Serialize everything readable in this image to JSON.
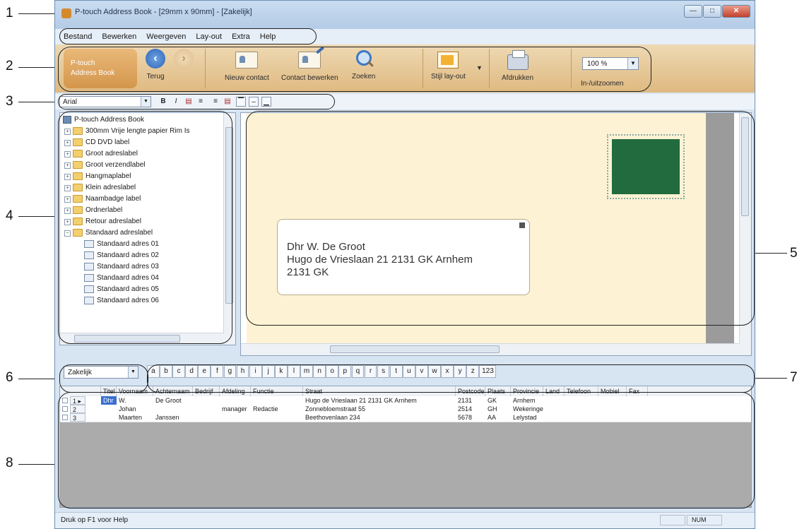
{
  "window": {
    "title": "P-touch Address Book - [29mm x 90mm] - [Zakelijk]",
    "controls": [
      "—",
      "□",
      "✕"
    ]
  },
  "menu": [
    "Bestand",
    "Bewerken",
    "Weergeven",
    "Lay-out",
    "Extra",
    "Help"
  ],
  "ribbon": {
    "brand_line1": "P-touch",
    "brand_line2": "Address Book",
    "back": "Terug",
    "forward": "",
    "new_contact": "Nieuw contact",
    "edit_contact": "Contact bewerken",
    "search": "Zoeken",
    "layout_style": "Stijl lay-out",
    "print": "Afdrukken",
    "zoom_value": "100 %",
    "zoom_label": "In-/uitzoomen"
  },
  "format_bar": {
    "font": "Arial",
    "bold": "B",
    "italic": "I"
  },
  "tree": {
    "root": "P-touch Address Book",
    "folders": [
      "300mm Vrije lengte papier  Rim Is",
      "CD DVD label",
      "Groot adreslabel",
      "Groot verzendlabel",
      "Hangmaplabel",
      "Klein adreslabel",
      "Naambadge label",
      "Ordnerlabel",
      "Retour adreslabel",
      "Standaard adreslabel"
    ],
    "children": [
      "Standaard adres 01",
      "Standaard adres 02",
      "Standaard adres 03",
      "Standaard adres 04",
      "Standaard adres 05",
      "Standaard adres 06"
    ]
  },
  "label_preview": {
    "line1": "Dhr W. De Groot",
    "line2": "Hugo de Vrieslaan 21 2131 GK Arnhem",
    "line3": "2131 GK"
  },
  "index": {
    "category": "Zakelijk",
    "letters": [
      "a",
      "b",
      "c",
      "d",
      "e",
      "f",
      "g",
      "h",
      "i",
      "j",
      "k",
      "l",
      "m",
      "n",
      "o",
      "p",
      "q",
      "r",
      "s",
      "t",
      "u",
      "v",
      "w",
      "x",
      "y",
      "z",
      "123"
    ]
  },
  "grid": {
    "columns": [
      "Titel",
      "Voornaam",
      "Achternaam",
      "Bedrijf",
      "Afdeling",
      "Functie",
      "Straat",
      "Postcode",
      "Plaats",
      "Provincie",
      "Land",
      "Telefoon",
      "Mobiel",
      "Fax"
    ],
    "rows": [
      {
        "num": "1",
        "titel": "Dhr",
        "voornaam": "W.",
        "achternaam": "De Groot",
        "bedrijf": "",
        "afdeling": "",
        "functie": "",
        "straat": "Hugo de Vrieslaan 21 2131 GK Arnhem",
        "postcode": "2131",
        "plaats": "GK",
        "provincie": "Arnhem"
      },
      {
        "num": "2",
        "titel": "",
        "voornaam": "Johan",
        "achternaam": "",
        "bedrijf": "",
        "afdeling": "manager",
        "functie": "Redactie",
        "straat": "Zonnebloemstraat 55",
        "postcode": "2514",
        "plaats": "GH",
        "provincie": "Wekeringe"
      },
      {
        "num": "3",
        "titel": "",
        "voornaam": "Maarten",
        "achternaam": "Janssen",
        "bedrijf": "",
        "afdeling": "",
        "functie": "",
        "straat": "Beethovenlaan 234",
        "postcode": "5678",
        "plaats": "AA",
        "provincie": "Lelystad"
      }
    ]
  },
  "status": {
    "help": "Druk op F1 voor Help",
    "num": "NUM"
  },
  "callouts": [
    "1",
    "2",
    "3",
    "4",
    "5",
    "6",
    "7",
    "8"
  ]
}
